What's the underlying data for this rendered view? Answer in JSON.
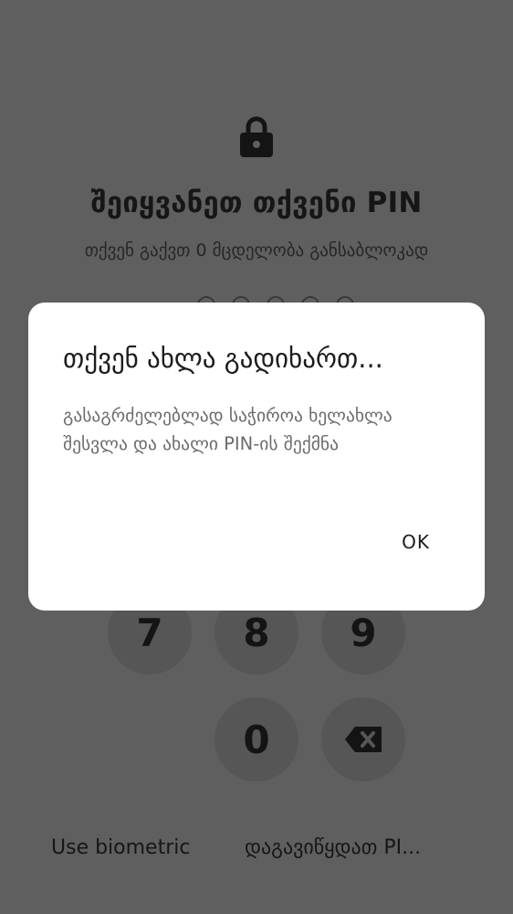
{
  "pin_screen": {
    "title": "შეიყვანეთ თქვენი PIN",
    "attempts_text": "თქვენ გაქვთ 0 მცდელობა განსაბლოკად",
    "keypad": {
      "row3": [
        "7",
        "8",
        "9"
      ],
      "zero": "0"
    },
    "backspace_icon": "backspace-icon",
    "lock_icon": "lock-icon",
    "use_biometric": "Use biometric",
    "forgot_pin": "დაგავიწყდათ PI..."
  },
  "dialog": {
    "title": "თქვენ ახლა გადიხართ...",
    "message": "გასაგრძელებლად საჭიროა ხელახლა შესვლა და ახალი PIN-ის შექმნა",
    "ok_label": "OK"
  }
}
